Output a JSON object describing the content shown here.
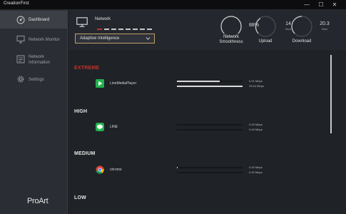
{
  "window": {
    "title": "CreationFirst",
    "minimize": "—",
    "maximize": "☐",
    "close": "✕"
  },
  "sidebar": {
    "items": [
      {
        "label": "Dashboard",
        "icon": "speedometer-icon",
        "active": true
      },
      {
        "label": "Network Monitor",
        "icon": "monitor-icon",
        "active": false
      },
      {
        "label": "Network Information",
        "icon": "network-info-icon",
        "active": false
      },
      {
        "label": "Settings",
        "icon": "gear-icon",
        "active": false
      }
    ],
    "brand": "ProArt"
  },
  "header": {
    "network_label": "Network",
    "mode_select": {
      "value": "Adaptive Intelligence"
    },
    "gauges": [
      {
        "name": "smoothness",
        "value": "88",
        "suffix": "%",
        "unit": "",
        "label": "Network Smoothness"
      },
      {
        "name": "upload",
        "value": "14",
        "unit": "Mbps",
        "label": "Upload"
      },
      {
        "name": "download",
        "value": "20.3",
        "unit": "Mbps",
        "label": "Download"
      }
    ]
  },
  "priorities": [
    {
      "label": "EXTREME",
      "color": "#c0342a"
    },
    {
      "label": "HIGH",
      "color": "#e6e6e6"
    },
    {
      "label": "MEDIUM",
      "color": "#e6e6e6"
    },
    {
      "label": "LOW",
      "color": "#e6e6e6"
    }
  ],
  "apps": [
    {
      "name": "LineMediaPlayer",
      "icon": "play-icon",
      "upload": "0.01",
      "download": "33.54",
      "unit": "Mbps",
      "upload_fill": 0.65,
      "download_fill": 1.0
    },
    {
      "name": "LINE",
      "icon": "line-chat-icon",
      "upload": "0.00",
      "download": "0.00",
      "unit": "Mbps",
      "upload_fill": 0.0,
      "download_fill": 0.0
    },
    {
      "name": "chrome",
      "icon": "chrome-icon",
      "upload": "0.00",
      "download": "0.00",
      "unit": "Mbps",
      "upload_fill": 0.01,
      "download_fill": 0.0
    }
  ]
}
